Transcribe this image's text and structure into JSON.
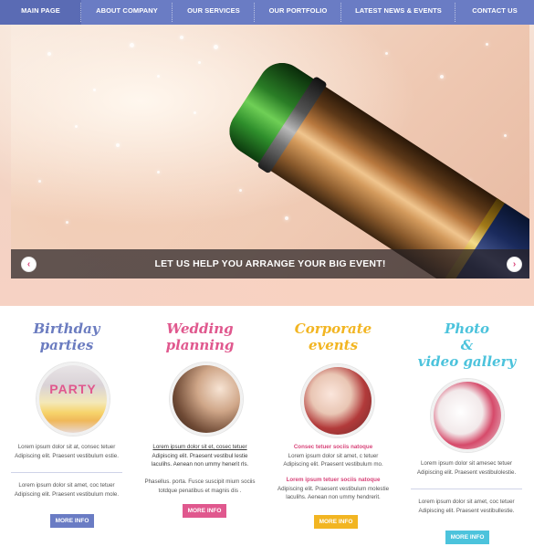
{
  "nav": {
    "items": [
      {
        "label": "MAIN PAGE",
        "active": true
      },
      {
        "label": "ABOUT COMPANY",
        "active": false
      },
      {
        "label": "OUR SERVICES",
        "active": false
      },
      {
        "label": "OUR PORTFOLIO",
        "active": false
      },
      {
        "label": "LATEST NEWS & EVENTS",
        "active": false
      },
      {
        "label": "CONTACT US",
        "active": false
      }
    ]
  },
  "hero": {
    "caption": "LET US HELP YOU ARRANGE YOUR BIG EVENT!",
    "prev_icon": "chevron-left-icon",
    "next_icon": "chevron-right-icon",
    "arrow_glyph_left": "‹",
    "arrow_glyph_right": "›"
  },
  "columns": {
    "birthday": {
      "title_line1": "Birthday",
      "title_line2": "parties",
      "color": "#6b7cc0",
      "image_text": "PARTY",
      "p1_line1": "Lorem ipsum dolor sit at, consec tetuer",
      "p1_line2": "Adipiscing elit. Praesent vestibulum estie.",
      "p2_line1": "Lorem ipsum dolor sit amet, coc tetuer",
      "p2_line2": "Adipiscing elit. Praesent vestibulum mole.",
      "button": "MORE INFO",
      "button_color": "#6a7cc4"
    },
    "wedding": {
      "title_line1": "Wedding",
      "title_line2": "planning",
      "color": "#e0588e",
      "p1_line1": "Lorem ipsum dolor sit et, cosec tetuer",
      "p1_line2": "Adipiscing elit. Praesent vestibul lestie",
      "p1_line3": "laculihs. Aenean non ummy henerit rls.",
      "p2_line1": "Phasellus. porta. Fusce suscipit mium sociis",
      "p2_line2": "totdque penatibus et magnis dis .",
      "button": "MORE INFO",
      "button_color": "#e0588e"
    },
    "corporate": {
      "title_line1": "Corporate",
      "title_line2": "events",
      "color": "#f2b522",
      "hl1": "Consec tetuer sociis natoque",
      "p1_line1": "Lorem ipsum dolor sit amet, c tetuer",
      "p1_line2": "Adipiscing elit. Praesent vestibulum mo.",
      "hl2": "Lorem ipsum tetuer sociis natoque",
      "p2_line1": "Adipiscing elit. Praesent vestibulum molestie",
      "p2_line2": "laculihs. Aenean non ummy hendrerit.",
      "hl_color": "#d8457a",
      "button": "MORE INFO",
      "button_color": "#f2b522"
    },
    "gallery": {
      "title_line1": "Photo",
      "title_line2": "&",
      "title_line3": "video gallery",
      "color": "#4cc3dc",
      "p1_line1": "Lorem ipsum dolor sit amesec tetuer",
      "p1_line2": "Adipiscing elit. Praesent vestibulolestie.",
      "p2_line1": "Lorem ipsum dolor sit amet, coc tetuer",
      "p2_line2": "Adipiscing elit. Praesent vestibullestie.",
      "button": "MORE INFO",
      "button_color": "#4cc3dc"
    }
  }
}
